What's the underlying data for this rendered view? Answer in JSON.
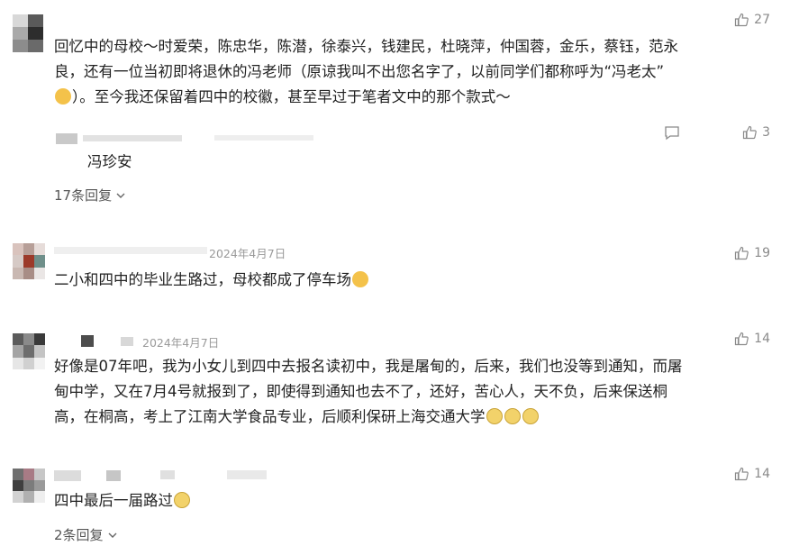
{
  "comments": [
    {
      "text_lines": [
        "回忆中的母校～时爱荣，陈忠华，陈潜，徐泰兴，钱建民，杜晓萍，仲国蓉，金乐，蔡钰，范永",
        "良，还有一位当初即将退休的冯老师（原谅我叫不出您名字了，以前同学们都称呼为“冯老太”",
        "）。至今我还保留着四中的校徽，甚至早过于笔者文中的那个款式～"
      ],
      "likes": "27",
      "reply": {
        "text": "冯珍安",
        "likes": "3"
      },
      "replies_label": "17条回复"
    },
    {
      "date": "2024年4月7日",
      "text_lines": [
        "二小和四中的毕业生路过，母校都成了停车场"
      ],
      "likes": "19"
    },
    {
      "date": "2024年4月7日",
      "text_lines": [
        "好像是07年吧，我为小女儿到四中去报名读初中，我是屠甸的，后来，我们也没等到通知，而屠",
        "甸中学，又在7月4号就报到了，即使得到通知也去不了，还好，苦心人，天不负，后来保送桐",
        "高，在桐高，考上了江南大学食品专业，后顺利保研上海交通大学"
      ],
      "likes": "14"
    },
    {
      "text_lines": [
        "四中最后一届路过"
      ],
      "likes": "14",
      "replies_label": "2条回复"
    }
  ],
  "icons": {
    "like": "thumbs-up-icon",
    "reply": "comment-bubble-icon",
    "expand": "chevron-down-icon",
    "emoji_think": "thinking-face-emoji",
    "emoji_cry": "crying-face-emoji",
    "emoji_smile": "smiling-face-emoji"
  },
  "colors": {
    "text": "#222222",
    "meta": "#8a8a8a"
  }
}
